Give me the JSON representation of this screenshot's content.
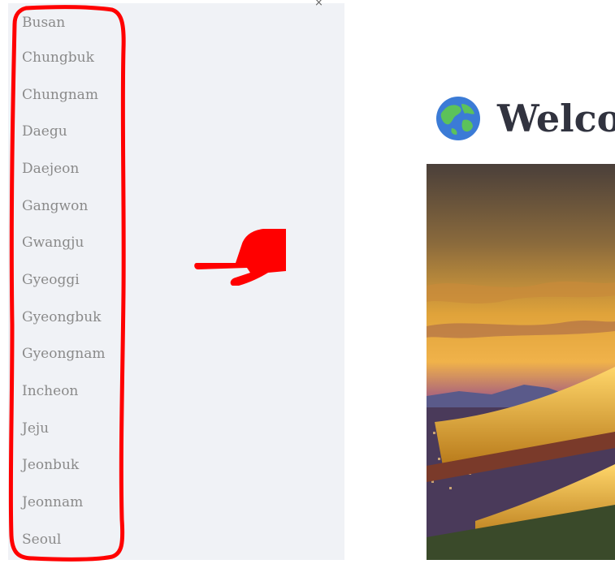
{
  "sidebar": {
    "close_glyph": "×",
    "items": [
      {
        "label": "Busan"
      },
      {
        "label": "Chungbuk"
      },
      {
        "label": "Chungnam"
      },
      {
        "label": "Daegu"
      },
      {
        "label": "Daejeon"
      },
      {
        "label": "Gangwon"
      },
      {
        "label": "Gwangju"
      },
      {
        "label": "Gyeoggi"
      },
      {
        "label": "Gyeongbuk"
      },
      {
        "label": "Gyeongnam"
      },
      {
        "label": "Incheon"
      },
      {
        "label": "Jeju"
      },
      {
        "label": "Jeonbuk"
      },
      {
        "label": "Jeonnam"
      },
      {
        "label": "Seoul"
      }
    ]
  },
  "main": {
    "title": "Welco",
    "title_icon": "globe-asia-icon"
  },
  "annotations": {
    "outline_color": "#ff0000",
    "pointer_icon": "pointing-hand-icon"
  },
  "colors": {
    "sidebar_bg": "#f0f2f6",
    "nav_text": "#8a8a8a",
    "title_text": "#31333f"
  }
}
